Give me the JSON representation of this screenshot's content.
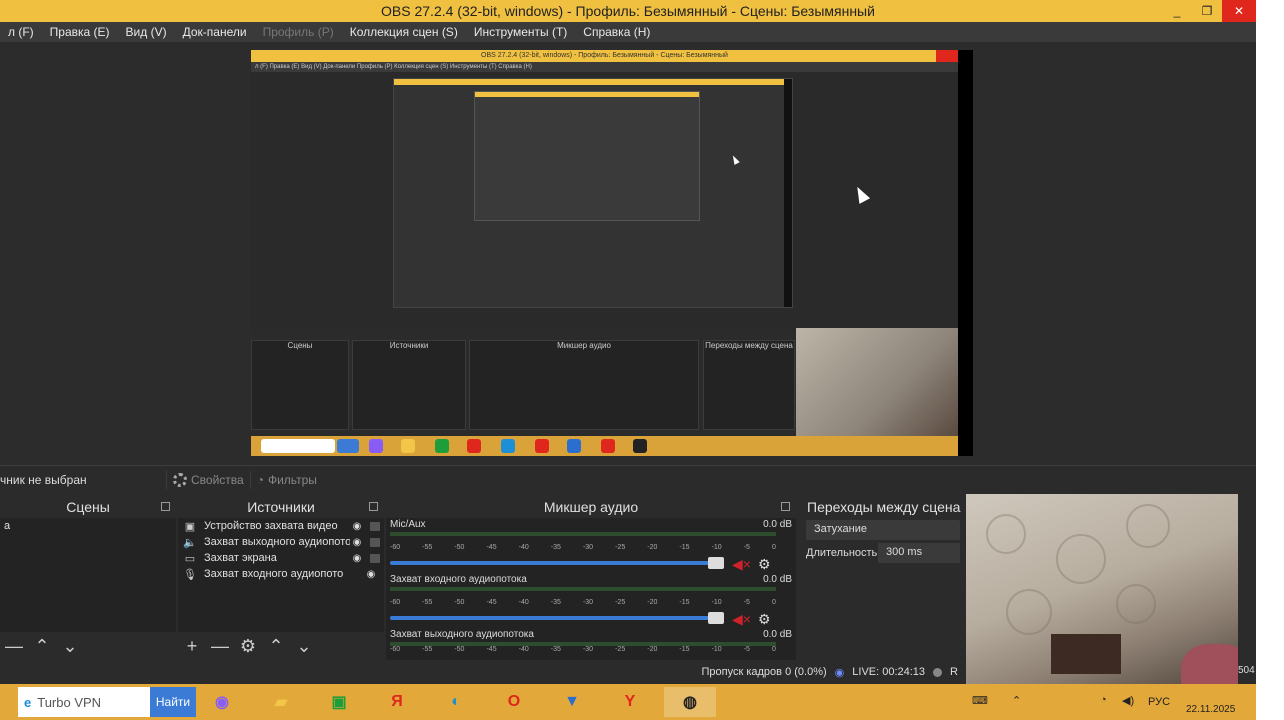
{
  "window": {
    "title": "OBS 27.2.4 (32-bit, windows) - Профиль: Безымянный - Сцены: Безымянный",
    "minimize": "_",
    "maximize": "❐",
    "close": "✕"
  },
  "menu": [
    {
      "label": "л (F)",
      "disabled": false
    },
    {
      "label": "Правка (E)",
      "disabled": false
    },
    {
      "label": "Вид (V)",
      "disabled": false
    },
    {
      "label": "Док-панели",
      "disabled": false
    },
    {
      "label": "Профиль (P)",
      "disabled": true
    },
    {
      "label": "Коллекция сцен (S)",
      "disabled": false
    },
    {
      "label": "Инструменты (T)",
      "disabled": false
    },
    {
      "label": "Справка (H)",
      "disabled": false
    }
  ],
  "source_toolbar": {
    "no_source": "чник не выбран",
    "properties": "Свойства",
    "filters": "Фильтры"
  },
  "scenes": {
    "title": "Сцены",
    "item": "а",
    "foot": [
      "—",
      "⌃",
      "⌄"
    ]
  },
  "sources": {
    "title": "Источники",
    "items": [
      {
        "icon": "▣",
        "name": "Устройство захвата видео"
      },
      {
        "icon": "🔈",
        "name": "Захват выходного аудиопото"
      },
      {
        "icon": "▭",
        "name": "Захват экрана"
      },
      {
        "icon": "🎙",
        "name": "Захват входного аудиопото"
      }
    ],
    "foot": [
      "+",
      "—",
      "⚙",
      "⌃",
      "⌄"
    ]
  },
  "mixer": {
    "title": "Микшер аудио",
    "ticks": [
      "-60",
      "-55",
      "-50",
      "-45",
      "-40",
      "-35",
      "-30",
      "-25",
      "-20",
      "-15",
      "-10",
      "-5",
      "0"
    ],
    "tracks": [
      {
        "name": "Mic/Aux",
        "db": "0.0 dB"
      },
      {
        "name": "Захват входного аудиопотока",
        "db": "0.0 dB"
      },
      {
        "name": "Захват выходного аудиопотока",
        "db": "0.0 dB"
      }
    ]
  },
  "transitions": {
    "title": "Переходы между сцена",
    "type": "Затухание",
    "duration_label": "Длительность",
    "duration": "300 ms"
  },
  "status": {
    "dropped": "Пропуск кадров 0 (0.0%)",
    "live": "LIVE: 00:24:13",
    "rec": "R",
    "extra": "504"
  },
  "nested_preview": {
    "title": "OBS 27.2.4 (32-bit, windows) - Профиль: Безымянный - Сцены: Безымянный",
    "menu": "л (F)   Правка (E)   Вид (V)   Док-панели   Профиль (P)   Коллекция сцен (S)   Инструменты (T)   Справка (H)",
    "panels": [
      "Сцены",
      "Источники",
      "Микшер аудио",
      "Переходы между сцена"
    ]
  },
  "taskbar": {
    "search_text": "Turbo VPN",
    "search_button": "Найти",
    "apps": [
      {
        "name": "alice-icon",
        "glyph": "◉",
        "color": "#8a5cf6"
      },
      {
        "name": "file-explorer-icon",
        "glyph": "▰",
        "color": "#f3c64a"
      },
      {
        "name": "store-icon",
        "glyph": "▣",
        "color": "#1e9e3a"
      },
      {
        "name": "yandex-icon",
        "glyph": "Я",
        "color": "#e0271d"
      },
      {
        "name": "edge-icon",
        "glyph": "◐",
        "color": "#1d8fd6"
      },
      {
        "name": "opera-icon",
        "glyph": "O",
        "color": "#e0271d"
      },
      {
        "name": "vpn-shield-icon",
        "glyph": "▼",
        "color": "#2a6fd0"
      },
      {
        "name": "yandex-browser-icon",
        "glyph": "Y",
        "color": "#e0271d"
      },
      {
        "name": "obs-icon",
        "glyph": "◍",
        "color": "#222222"
      }
    ],
    "tray": {
      "lang": "РУС",
      "date": "22.11.2025"
    }
  }
}
